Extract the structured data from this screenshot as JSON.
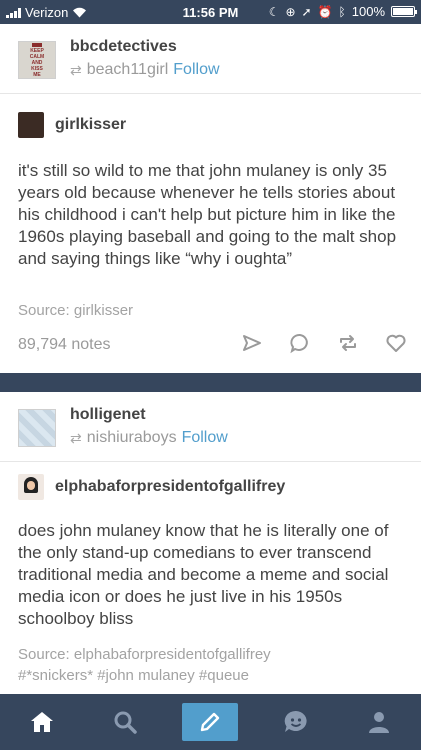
{
  "status_bar": {
    "carrier": "Verizon",
    "time": "11:56 PM",
    "battery": "100%",
    "battery_level": 1.0
  },
  "posts": [
    {
      "blog_name": "bbcdetectives",
      "reblogged_from": "beach11girl",
      "follow_label": "Follow",
      "avatar_text": [
        "KEEP",
        "CALM",
        "AND",
        "KISS",
        "ME"
      ],
      "source_blog": "girlkisser",
      "body": "it's still so wild to me that john mulaney is only 35 years old because whenever he tells stories about his childhood i can't help but picture him in like the 1960s playing baseball and going to the malt shop and saying things like “why i oughta”",
      "source_line": "Source: girlkisser",
      "notes": "89,794 notes"
    },
    {
      "blog_name": "holligenet",
      "reblogged_from": "nishiuraboys",
      "follow_label": "Follow",
      "source_blog": "elphabaforpresidentofgallifrey",
      "body": "does john mulaney know that he is literally one of the only stand-up comedians to ever transcend traditional media and become a meme and social media icon or does he just live in his 1950s schoolboy bliss",
      "source_line": "Source: elphabaforpresidentofgallifrey",
      "tags": "#*snickers*  #john mulaney  #queue"
    }
  ],
  "icons": {
    "actions": [
      "share-icon",
      "reply-icon",
      "reblog-icon",
      "like-icon"
    ],
    "tabbar": [
      "home-icon",
      "search-icon",
      "compose-icon",
      "activity-icon",
      "account-icon"
    ]
  },
  "colors": {
    "navy": "#36465d",
    "link_blue": "#529ecc",
    "text": "#444444",
    "muted": "#a3a3a3"
  }
}
